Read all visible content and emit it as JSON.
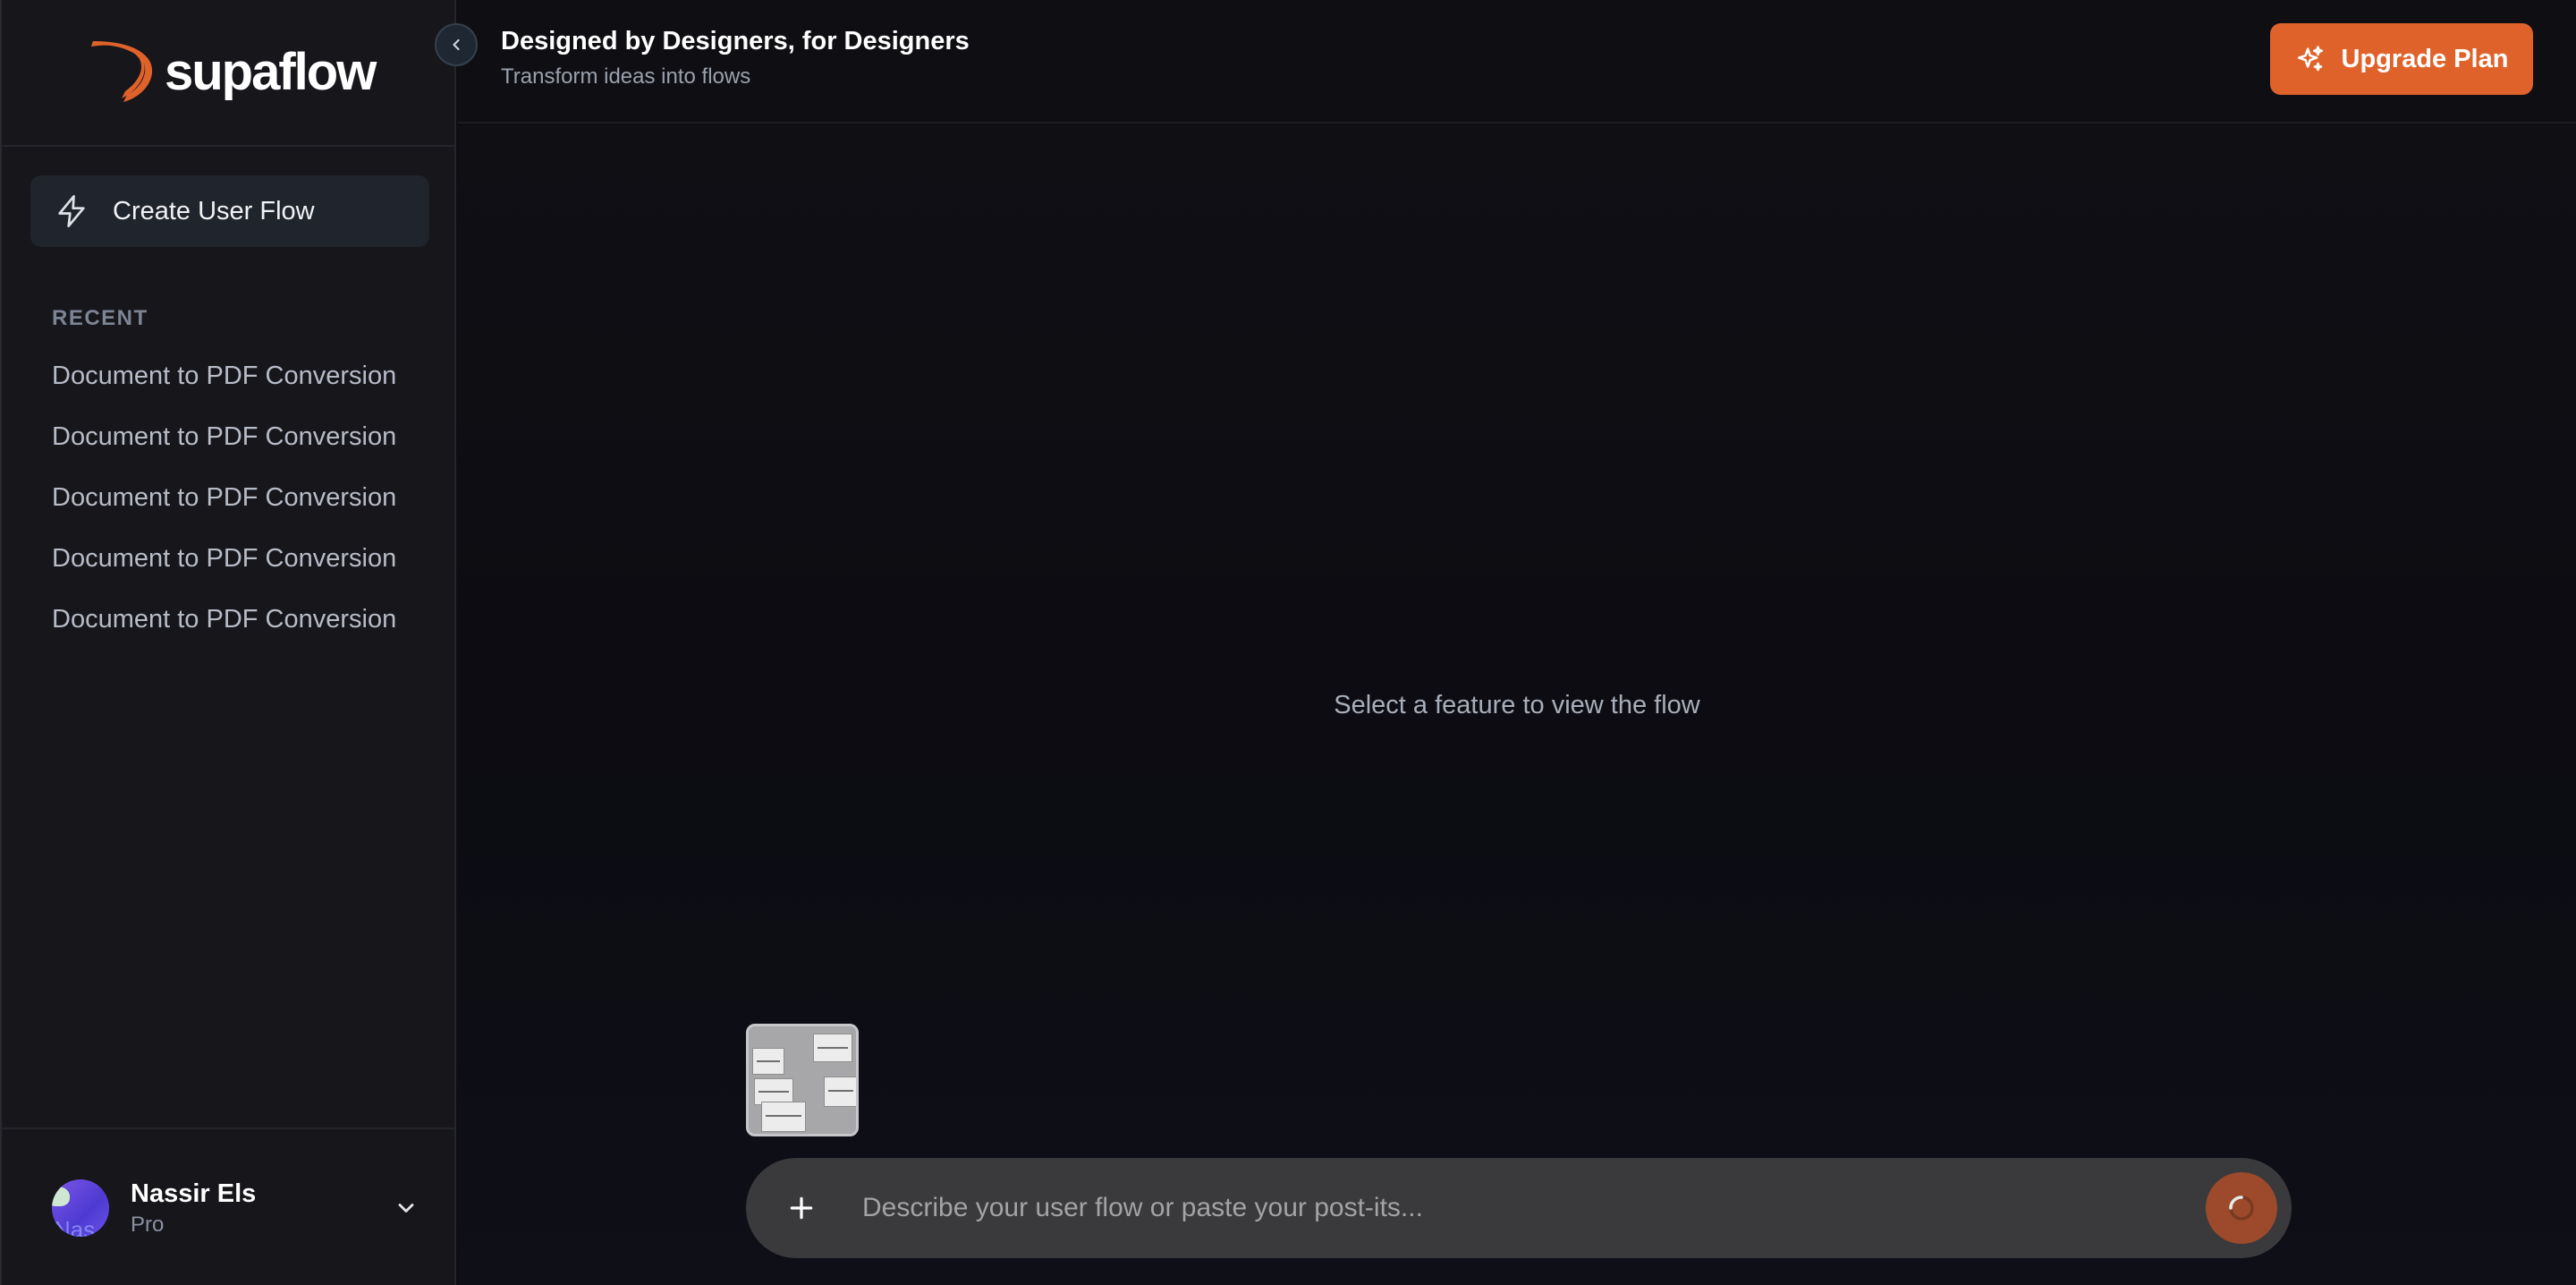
{
  "brand": {
    "name": "supaflow",
    "accent": "#e0622b"
  },
  "header": {
    "title": "Designed by Designers, for Designers",
    "subtitle": "Transform ideas into flows",
    "upgrade_label": "Upgrade Plan"
  },
  "sidebar": {
    "create_label": "Create User Flow",
    "recent_title": "RECENT",
    "recent_items": [
      {
        "label": "Document to PDF Conversion"
      },
      {
        "label": "Document to PDF Conversion"
      },
      {
        "label": "Document to PDF Conversion"
      },
      {
        "label": "Document to PDF Conversion"
      },
      {
        "label": "Document to PDF Conversion"
      }
    ]
  },
  "user": {
    "name": "Nassir Els",
    "plan": "Pro",
    "avatar_initials": "Nas"
  },
  "main": {
    "empty_message": "Select a feature to view the flow"
  },
  "composer": {
    "placeholder": "Describe your user flow or paste your post-its...",
    "value": ""
  },
  "icons": {
    "create": "lightning-icon",
    "upgrade": "sparkles-icon",
    "collapse": "chevron-left-icon",
    "user_menu": "chevron-down-icon",
    "attach": "plus-icon",
    "send": "loading-spinner-icon"
  }
}
